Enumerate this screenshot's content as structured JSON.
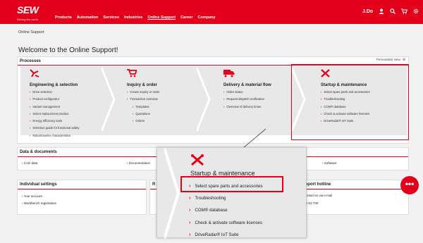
{
  "header": {
    "logo": "SEW",
    "tagline": "Driving the world",
    "nav": [
      "Products",
      "Automation",
      "Services",
      "Industries",
      "Online Support",
      "Career",
      "Company"
    ],
    "active_nav": "Online Support",
    "user": "J.Do"
  },
  "breadcrumb": "Online Support",
  "page_title": "Welcome to the Online Support!",
  "processes": {
    "title": "Processes",
    "personalize": "Personalize view",
    "columns": [
      {
        "title": "Engineering & selection",
        "items": [
          "Drive selection",
          "Product configurator",
          "Variant management",
          "Select replacement product",
          "Energy efficiency tools",
          "Selection guide for functional safety",
          "Motor/inverter characteristics"
        ]
      },
      {
        "title": "Inquiry & order",
        "items": [
          "Create inquiry or order",
          "Transaction overview"
        ],
        "subitems": [
          "Templates",
          "Quotations",
          "Orders"
        ]
      },
      {
        "title": "Delivery & material flow",
        "items": [
          "Order status",
          "Request dispatch notification",
          "Overview of delivery times"
        ]
      },
      {
        "title": "Startup & maintenance",
        "items": [
          "Select spare parts and accessories",
          "Troubleshooting",
          "COM® database",
          "Check & activate software licenses",
          "DriveRadar® IoT Suite"
        ]
      }
    ]
  },
  "data_documents": {
    "title": "Data & documents",
    "items": [
      "CAD data",
      "Documentation",
      "Software"
    ]
  },
  "individual": {
    "title": "Individual settings",
    "items": [
      "Your account",
      "Workbench registration"
    ]
  },
  "r_panel_title": "R",
  "hotline": {
    "title": "Support hotline",
    "line1": "Contact us via e-mail",
    "line2": "44 53 700"
  },
  "zoom": {
    "title": "Startup & maintenance",
    "items": [
      "Select spare parts and accessories",
      "Troubleshooting",
      "COM® database",
      "Check & activate software licenses",
      "DriveRadar® IoT Suite"
    ]
  },
  "colors": {
    "brand": "#e2001a",
    "panel_bg": "#e8e8e8"
  }
}
